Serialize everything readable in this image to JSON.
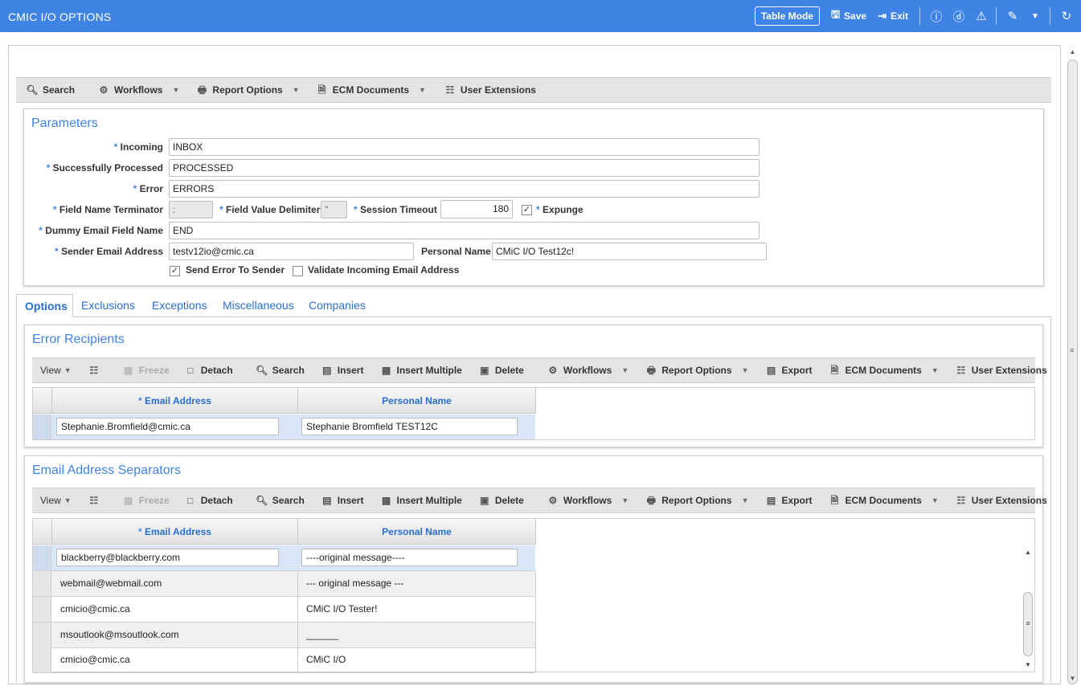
{
  "header": {
    "title": "CMIC I/O OPTIONS",
    "table_mode": "Table Mode",
    "save": "Save",
    "exit": "Exit"
  },
  "main_toolbar": {
    "search": "Search",
    "workflows": "Workflows",
    "report_options": "Report Options",
    "ecm_documents": "ECM Documents",
    "user_extensions": "User Extensions"
  },
  "parameters": {
    "title": "Parameters",
    "incoming_label": "Incoming",
    "incoming_value": "INBOX",
    "processed_label": "Successfully Processed",
    "processed_value": "PROCESSED",
    "error_label": "Error",
    "error_value": "ERRORS",
    "field_name_terminator_label": "Field Name Terminator",
    "field_name_terminator_value": ":",
    "field_value_delimiter_label": "Field Value Delimiter",
    "field_value_delimiter_value": "\"",
    "session_timeout_label": "Session Timeout",
    "session_timeout_value": "180",
    "expunge_label": "Expunge",
    "expunge_checked": true,
    "dummy_email_label": "Dummy Email Field Name",
    "dummy_email_value": "END",
    "sender_email_label": "Sender Email Address",
    "sender_email_value": "testv12io@cmic.ca",
    "personal_name_label": "Personal Name",
    "personal_name_value": "CMiC I/O Test12c!",
    "send_error_label": "Send Error To Sender",
    "send_error_checked": true,
    "validate_incoming_label": "Validate Incoming Email Address",
    "validate_incoming_checked": false
  },
  "tabs": [
    "Options",
    "Exclusions",
    "Exceptions",
    "Miscellaneous",
    "Companies"
  ],
  "grid_toolbar": {
    "view": "View",
    "freeze": "Freeze",
    "detach": "Detach",
    "search": "Search",
    "insert": "Insert",
    "insert_multiple": "Insert Multiple",
    "delete": "Delete",
    "workflows": "Workflows",
    "report_options": "Report Options",
    "export": "Export",
    "ecm_documents": "ECM Documents",
    "user_extensions": "User Extensions"
  },
  "error_recipients": {
    "title": "Error Recipients",
    "col_email": "Email Address",
    "col_name": "Personal Name",
    "rows": [
      {
        "email": "Stephanie.Bromfield@cmic.ca",
        "name": "Stephanie Bromfield TEST12C"
      }
    ]
  },
  "separators": {
    "title": "Email Address Separators",
    "col_email": "Email Address",
    "col_name": "Personal Name",
    "rows": [
      {
        "email": "blackberry@blackberry.com",
        "name": "----original message----"
      },
      {
        "email": "webmail@webmail.com",
        "name": "--- original message ---"
      },
      {
        "email": "cmicio@cmic.ca",
        "name": "CMiC I/O Tester!"
      },
      {
        "email": "msoutlook@msoutlook.com",
        "name": "______"
      },
      {
        "email": "cmicio@cmic.ca",
        "name": "CMiC I/O"
      }
    ]
  }
}
